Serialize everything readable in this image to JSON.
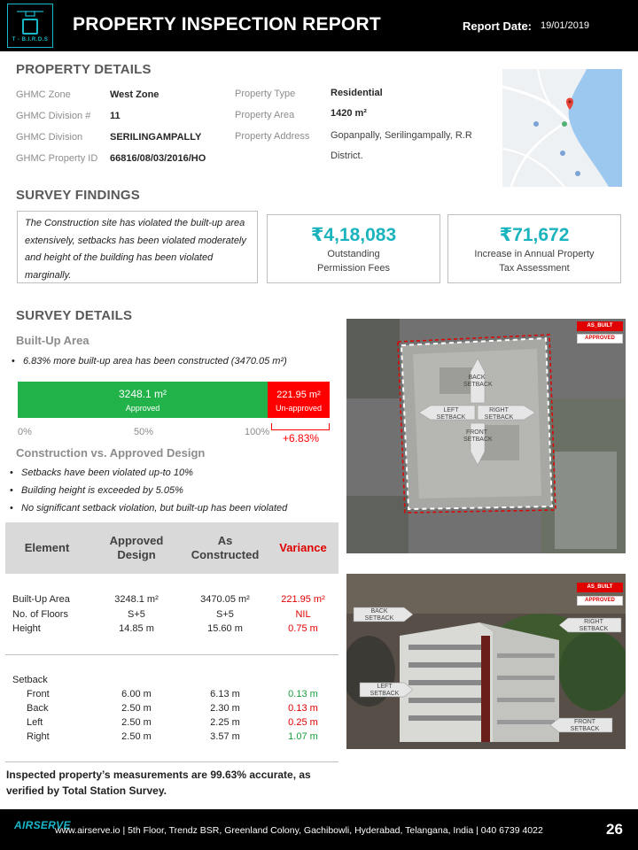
{
  "header": {
    "logo_text": "T - B.I.R.D.S",
    "title": "PROPERTY INSPECTION REPORT",
    "date_label": "Report Date:",
    "date_value": "19/01/2019"
  },
  "property_details": {
    "title": "PROPERTY DETAILS",
    "left": [
      {
        "label": "GHMC Zone",
        "value": "West Zone"
      },
      {
        "label": "GHMC Division  #",
        "value": "11"
      },
      {
        "label": "GHMC Division",
        "value": "SERILINGAMPALLY"
      },
      {
        "label": "GHMC Property ID",
        "value": "66816/08/03/2016/HO"
      }
    ],
    "right": [
      {
        "label": "Property Type",
        "value": "Residential"
      },
      {
        "label": "Property Area",
        "value": "1420 m²"
      },
      {
        "label": "Property Address",
        "value": "Gopanpally, Serilingampally, R.R District."
      }
    ]
  },
  "survey_findings": {
    "title": "SURVEY FINDINGS",
    "summary": "The Construction site has violated the built-up area extensively, setbacks has been violated moderately  and height of the building has been violated marginally.",
    "fees_amount": "₹4,18,083",
    "fees_label_1": "Outstanding",
    "fees_label_2": "Permission Fees",
    "tax_amount": "₹71,672",
    "tax_label_1": "Increase in Annual Property",
    "tax_label_2": "Tax Assessment"
  },
  "survey_details": {
    "title": "SURVEY DETAILS",
    "builtup_title": "Built-Up  Area",
    "builtup_bullet": "6.83% more built-up area has been constructed  (3470.05 m²)",
    "bar": {
      "approved_value": "3248.1  m²",
      "approved_label": "Approved",
      "unapproved_value": "221.95 m²",
      "unapproved_label": "Un-approved",
      "approved_fraction": 0.9363,
      "axis": [
        "0%",
        "50%",
        "100%"
      ],
      "change": "+6.83%"
    },
    "comparison_title": "Construction  vs.  Approved Design",
    "bullets": [
      "Setbacks have been violated up-to 10%",
      "Building height is exceeded by 5.05%",
      "No significant setback violation, but built-up has been violated"
    ]
  },
  "table": {
    "headers": [
      "Element",
      "Approved Design",
      "As Constructed",
      "Variance"
    ],
    "rows": [
      {
        "element": "Built-Up Area",
        "approved": "3248.1 m²",
        "constructed": "3470.05 m²",
        "variance": "221.95 m²",
        "color": "red"
      },
      {
        "element": "No. of Floors",
        "approved": "S+5",
        "constructed": "S+5",
        "variance": "NIL",
        "color": "red"
      },
      {
        "element": "Height",
        "approved": "14.85 m",
        "constructed": "15.60 m",
        "variance": "0.75 m",
        "color": "red"
      }
    ],
    "setback_label": "Setback",
    "setbacks": [
      {
        "element": "Front",
        "approved": "6.00 m",
        "constructed": "6.13 m",
        "variance": "0.13 m",
        "color": "green"
      },
      {
        "element": "Back",
        "approved": "2.50 m",
        "constructed": "2.30 m",
        "variance": "0.13 m",
        "color": "red"
      },
      {
        "element": "Left",
        "approved": "2.50 m",
        "constructed": "2.25 m",
        "variance": "0.25 m",
        "color": "red"
      },
      {
        "element": "Right",
        "approved": "2.50 m",
        "constructed": "3.57 m",
        "variance": "1.07 m",
        "color": "green"
      }
    ]
  },
  "note": "Inspected property’s measurements are 99.63%  accurate, as verified by Total Station Survey.",
  "photos": {
    "legend_as_built": "AS_BUILT",
    "legend_approved": "APPROVED",
    "top_labels": {
      "back": "BACK SETBACK",
      "left": "LEFT SETBACK",
      "right": "RIGHT SETBACK",
      "front": "FRONT SETBACK"
    },
    "bottom_labels": {
      "back": "BACK SETBACK",
      "right": "RIGHT SETBACK",
      "left": "LEFT SETBACK",
      "front": "FRONT SETBACK"
    }
  },
  "footer": {
    "logo": "AIRSERVE",
    "text": "www.airserve.io |    5th Floor, Trendz BSR, Greenland Colony, Gachibowli, Hyderabad, Telangana, India    |    040 6739 4022",
    "page": "26"
  },
  "colors": {
    "accent": "#1bb3bd",
    "approved": "#21b34a",
    "unapproved": "#ff0000"
  }
}
